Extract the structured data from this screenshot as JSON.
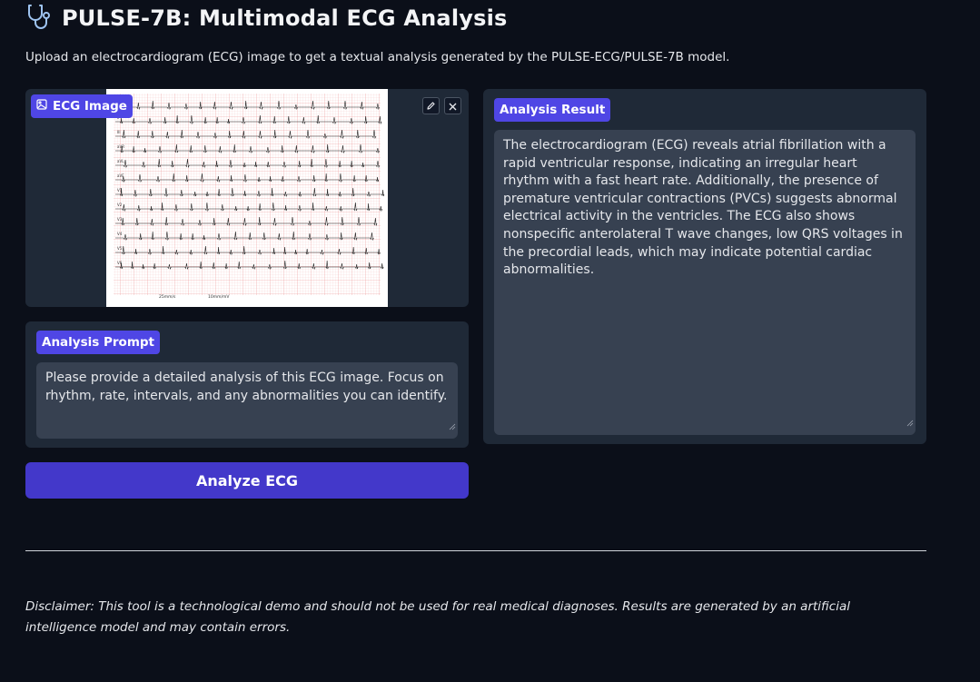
{
  "header": {
    "title": "PULSE-7B: Multimodal ECG Analysis",
    "icon": "stethoscope-icon",
    "subtitle": "Upload an electrocardiogram (ECG) image to get a textual analysis generated by the PULSE-ECG/PULSE-7B model."
  },
  "image_panel": {
    "label": "ECG Image",
    "label_icon": "image-icon",
    "edit_icon": "pencil-icon",
    "clear_icon": "close-icon",
    "ecg": {
      "lead_labels": [
        "I",
        "II",
        "III",
        "aVR",
        "aVL",
        "aVF",
        "V1",
        "V2",
        "V3",
        "V4",
        "V5",
        "V6"
      ],
      "footer_left": "25mm/s",
      "footer_right": "10mm/mV"
    }
  },
  "prompt_panel": {
    "label": "Analysis Prompt",
    "value": "Please provide a detailed analysis of this ECG image. Focus on rhythm, rate, intervals, and any abnormalities you can identify."
  },
  "analyze_button": {
    "label": "Analyze ECG"
  },
  "result_panel": {
    "label": "Analysis Result",
    "value": "The electrocardiogram (ECG) reveals atrial fibrillation with a rapid ventricular response, indicating an irregular heart rhythm with a fast heart rate. Additionally, the presence of premature ventricular contractions (PVCs) suggests abnormal electrical activity in the ventricles. The ECG also shows nonspecific anterolateral T wave changes, low QRS voltages in the precordial leads, which may indicate potential cardiac abnormalities."
  },
  "footer": {
    "disclaimer": "Disclaimer: This tool is a technological demo and should not be used for real medical diagnoses. Results are generated by an artificial intelligence model and may contain errors."
  },
  "colors": {
    "background": "#0b0f19",
    "panel": "#1f2937",
    "accent": "#4f46e5",
    "button": "#4338ca",
    "textbox": "#374151"
  }
}
